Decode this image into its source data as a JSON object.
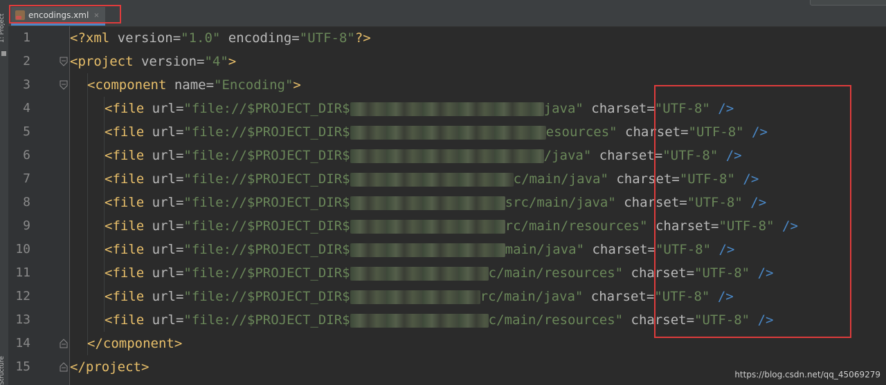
{
  "sidebar": {
    "project_label": "1: Project",
    "structure_label": "Structure"
  },
  "tab": {
    "label": "encodings.xml",
    "close": "×"
  },
  "lines": [
    {
      "n": "1"
    },
    {
      "n": "2"
    },
    {
      "n": "3"
    },
    {
      "n": "4"
    },
    {
      "n": "5"
    },
    {
      "n": "6"
    },
    {
      "n": "7"
    },
    {
      "n": "8"
    },
    {
      "n": "9"
    },
    {
      "n": "10"
    },
    {
      "n": "11"
    },
    {
      "n": "12"
    },
    {
      "n": "13"
    },
    {
      "n": "14"
    },
    {
      "n": "15"
    }
  ],
  "code": {
    "l1": {
      "open": "<?xml",
      "a1": " version=",
      "v1": "\"1.0\"",
      "a2": " encoding=",
      "v2": "\"UTF-8\"",
      "close": "?>"
    },
    "l2": {
      "open": "<project",
      "a1": " version=",
      "v1": "\"4\"",
      "close": ">"
    },
    "l3": {
      "open": "<component",
      "a1": " name=",
      "v1": "\"Encoding\"",
      "close": ">"
    },
    "files": [
      {
        "tail": "java\""
      },
      {
        "tail": "esources\""
      },
      {
        "tail": "/java\""
      },
      {
        "tail": "c/main/java\""
      },
      {
        "tail": "src/main/java\""
      },
      {
        "tail": "rc/main/resources\""
      },
      {
        "tail": "main/java\""
      },
      {
        "tail": "c/main/resources\""
      },
      {
        "tail": "rc/main/java\""
      },
      {
        "tail": "c/main/resources\""
      }
    ],
    "file_open": "<file",
    "url_attr": " url=",
    "url_prefix": "\"file://$PROJECT_DIR$",
    "charset_attr": " charset=",
    "charset_val": "\"UTF-8\"",
    "self_close": " />",
    "l14": {
      "tag": "</component>"
    },
    "l15": {
      "tag": "</project>"
    }
  },
  "watermark": "https://blog.csdn.net/qq_45069279",
  "colors": {
    "highlight_box": "#e03c3c",
    "tag": "#e8bf6a",
    "value": "#6a8759"
  }
}
